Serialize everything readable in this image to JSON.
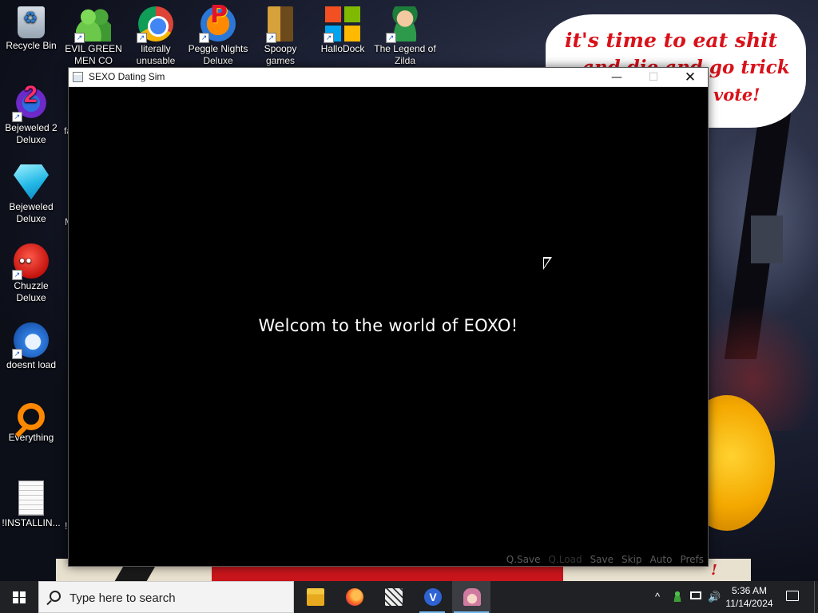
{
  "wallpaper": {
    "speech_bubble": {
      "line1": "it's time to eat shit",
      "line2": "and die and go trick",
      "line3": "vote!"
    },
    "floor_mark": "!"
  },
  "desktop": {
    "icons": [
      {
        "label": "Recycle Bin",
        "icon": "recycle-bin-icon"
      },
      {
        "label": "EVIL GREEN MEN CO",
        "icon": "people-icon"
      },
      {
        "label": "literally unusable",
        "icon": "chrome-icon"
      },
      {
        "label": "Peggle Nights Deluxe",
        "icon": "peggle-icon"
      },
      {
        "label": "Spoopy games",
        "icon": "spoopy-icon"
      },
      {
        "label": "HalloDock",
        "icon": "windows-icon"
      },
      {
        "label": "The Legend of Zilda",
        "icon": "zilda-icon"
      },
      {
        "label": "Bejeweled 2 Deluxe",
        "icon": "bejeweled-2-icon"
      },
      {
        "label": "Bejeweled Deluxe",
        "icon": "bejeweled-icon"
      },
      {
        "label": "Chuzzle Deluxe",
        "icon": "chuzzle-icon"
      },
      {
        "label": "doesnt load",
        "icon": "thunderbird-icon"
      },
      {
        "label": "Everything",
        "icon": "everything-icon"
      },
      {
        "label": "!INSTALLIN...",
        "icon": "text-file-icon"
      }
    ],
    "clipped_labels": [
      "fa",
      "M",
      "!"
    ]
  },
  "window": {
    "title": "SEXO Dating Sim",
    "controls": {
      "minimize": "—",
      "maximize": "☐",
      "close": "✕"
    },
    "game": {
      "dialogue": "Welcom to the world of EOXO!",
      "quick_menu": [
        {
          "label": "Q.Save",
          "enabled": true
        },
        {
          "label": "Q.Load",
          "enabled": false
        },
        {
          "label": "Save",
          "enabled": true
        },
        {
          "label": "Skip",
          "enabled": true
        },
        {
          "label": "Auto",
          "enabled": true
        },
        {
          "label": "Prefs",
          "enabled": true
        }
      ]
    }
  },
  "taskbar": {
    "search_placeholder": "Type here to search",
    "apps": [
      "file-explorer-icon",
      "firefox-icon",
      "game-icon",
      "v-app-icon",
      "dating-sim-icon"
    ],
    "v_app_letter": "V",
    "tray": {
      "chevron": "^",
      "volume": "🔊",
      "time": "5:36 AM",
      "date": "11/14/2024"
    }
  }
}
